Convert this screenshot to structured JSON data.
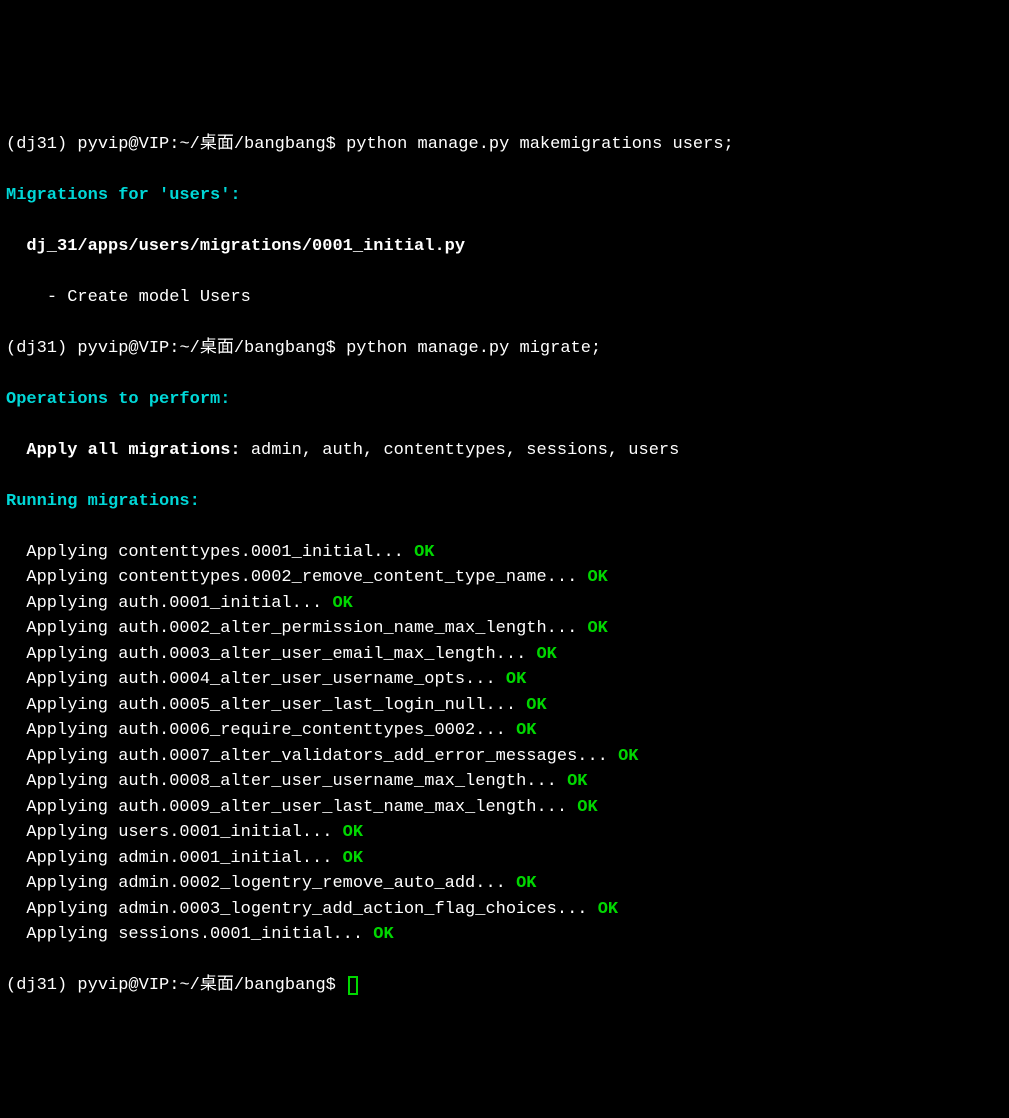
{
  "prompt1": {
    "env": "(dj31) ",
    "userhost": "pyvip@VIP",
    "path": ":~/桌面/bangbang$ ",
    "command": "python manage.py makemigrations users;"
  },
  "makemigrations": {
    "header": "Migrations for 'users':",
    "file": "dj_31/apps/users/migrations/0001_initial.py",
    "action": "- Create model Users"
  },
  "prompt2": {
    "env": "(dj31) ",
    "userhost": "pyvip@VIP",
    "path": ":~/桌面/bangbang$ ",
    "command": "python manage.py migrate;"
  },
  "operations": {
    "header": "Operations to perform:",
    "apply_label": "Apply all migrations:",
    "apply_list": " admin, auth, contenttypes, sessions, users"
  },
  "running": {
    "header": "Running migrations:",
    "items": [
      {
        "text": "Applying contenttypes.0001_initial... ",
        "status": "OK"
      },
      {
        "text": "Applying contenttypes.0002_remove_content_type_name... ",
        "status": "OK"
      },
      {
        "text": "Applying auth.0001_initial... ",
        "status": "OK"
      },
      {
        "text": "Applying auth.0002_alter_permission_name_max_length... ",
        "status": "OK"
      },
      {
        "text": "Applying auth.0003_alter_user_email_max_length... ",
        "status": "OK"
      },
      {
        "text": "Applying auth.0004_alter_user_username_opts... ",
        "status": "OK"
      },
      {
        "text": "Applying auth.0005_alter_user_last_login_null... ",
        "status": "OK"
      },
      {
        "text": "Applying auth.0006_require_contenttypes_0002... ",
        "status": "OK"
      },
      {
        "text": "Applying auth.0007_alter_validators_add_error_messages... ",
        "status": "OK"
      },
      {
        "text": "Applying auth.0008_alter_user_username_max_length... ",
        "status": "OK"
      },
      {
        "text": "Applying auth.0009_alter_user_last_name_max_length... ",
        "status": "OK"
      },
      {
        "text": "Applying users.0001_initial... ",
        "status": "OK"
      },
      {
        "text": "Applying admin.0001_initial... ",
        "status": "OK"
      },
      {
        "text": "Applying admin.0002_logentry_remove_auto_add... ",
        "status": "OK"
      },
      {
        "text": "Applying admin.0003_logentry_add_action_flag_choices... ",
        "status": "OK"
      },
      {
        "text": "Applying sessions.0001_initial... ",
        "status": "OK"
      }
    ]
  },
  "prompt3": {
    "env": "(dj31) ",
    "userhost": "pyvip@VIP",
    "path": ":~/桌面/bangbang$ "
  }
}
